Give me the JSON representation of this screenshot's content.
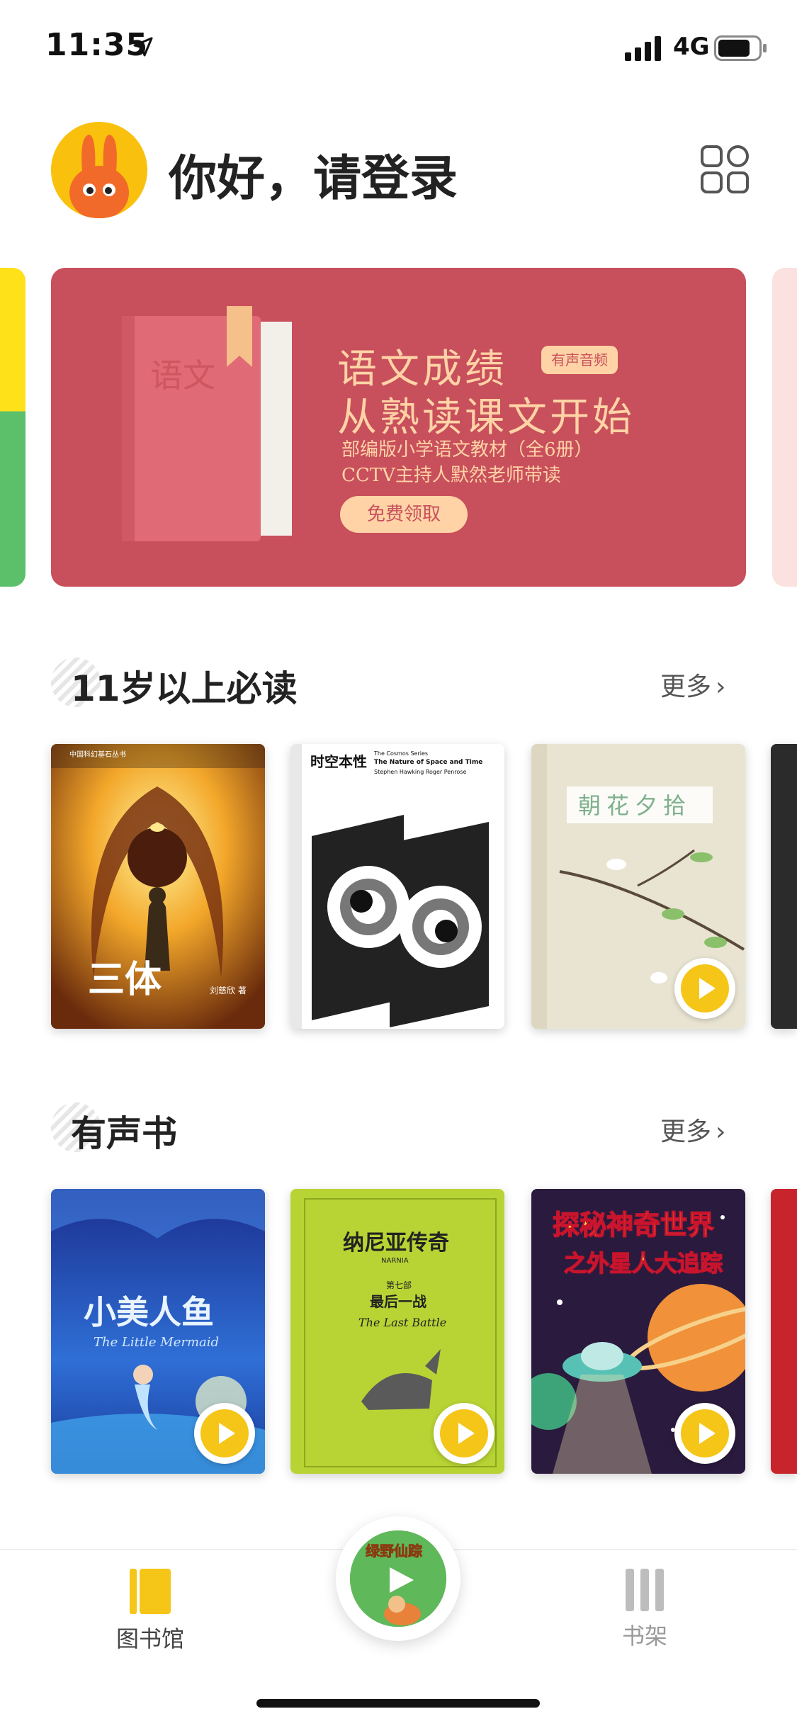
{
  "status_bar": {
    "time": "11:35",
    "network": "4G"
  },
  "header": {
    "greeting": "你好，请登录",
    "avatar_icon": "rabbit-avatar-icon",
    "grid_icon": "grid-menu-icon"
  },
  "banner": {
    "book_label": "语文",
    "title_line1": "语文成绩",
    "badge": "有声音频",
    "title_line2": "从熟读课文开始",
    "subtitle_line1": "部编版小学语文教材（全6册）",
    "subtitle_line2": "CCTV主持人默然老师带读",
    "cta": "免费领取",
    "colors": {
      "background": "#c84f5c",
      "accent": "#ffd3a6"
    }
  },
  "sections": [
    {
      "title": "11岁以上必读",
      "more": "更多",
      "books": [
        {
          "title": "三体",
          "author": "刘慈欣 著",
          "series": "中国科幻基石丛书",
          "audio": false
        },
        {
          "title_cn": "时空本性",
          "title_en": "The Nature of Space and Time",
          "series": "The Cosmos Series",
          "authors_en": "Stephen Hawking\nRoger Penrose",
          "audio": false
        },
        {
          "title": "朝花夕拾",
          "audio": true
        }
      ]
    },
    {
      "title": "有声书",
      "more": "更多",
      "books": [
        {
          "title": "小美人鱼",
          "title_en": "The Little Mermaid",
          "audio": true
        },
        {
          "title": "纳尼亚传奇",
          "series_en": "NARNIA",
          "volume": "第七部",
          "subtitle": "最后一战",
          "subtitle_en": "The Last Battle",
          "audio": true
        },
        {
          "title_line1": "探秘神奇世界",
          "title_line2": "之外星人大追踪",
          "audio": true
        }
      ]
    }
  ],
  "now_playing": {
    "title": "绿野仙踪"
  },
  "tabbar": {
    "library": "图书馆",
    "bookshelf": "书架",
    "active_color": "#f5c518",
    "inactive_color": "#aaaaaa"
  }
}
